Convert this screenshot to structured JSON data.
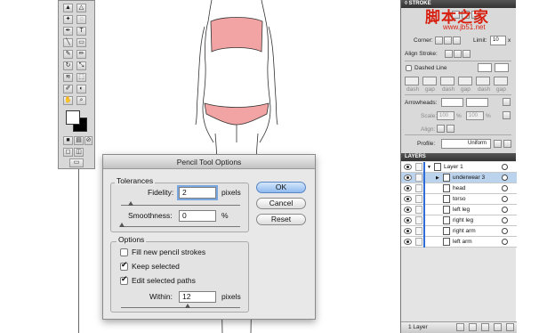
{
  "watermark": {
    "text": "脚本之家",
    "url": "www.jb51.net"
  },
  "stroke_panel": {
    "title": "◊ STROKE",
    "corner_label": "Corner:",
    "limit_label": "Limit:",
    "limit_value": "10",
    "limit_suffix": "x",
    "align_stroke_label": "Align Stroke:",
    "dashed_line_label": "Dashed Line",
    "dash_labels": [
      "dash",
      "gap",
      "dash",
      "gap",
      "dash",
      "gap"
    ],
    "arrowheads_label": "Arrowheads:",
    "scale_label": "Scale:",
    "scale_start": "100",
    "scale_end": "100",
    "scale_unit": "%",
    "align_label": "Align:",
    "profile_label": "Profile:",
    "profile_value": "Uniform"
  },
  "layers_panel": {
    "title": "LAYERS",
    "layers": [
      {
        "name": "Layer 1",
        "selected": false,
        "level": 0
      },
      {
        "name": "underwear 3",
        "selected": true,
        "level": 1
      },
      {
        "name": "head",
        "selected": false,
        "level": 1
      },
      {
        "name": "torso",
        "selected": false,
        "level": 1
      },
      {
        "name": "left leg",
        "selected": false,
        "level": 1
      },
      {
        "name": "right leg",
        "selected": false,
        "level": 1
      },
      {
        "name": "right arm",
        "selected": false,
        "level": 1
      },
      {
        "name": "left arm",
        "selected": false,
        "level": 1
      }
    ],
    "footer_label": "1 Layer"
  },
  "dialog": {
    "title": "Pencil Tool Options",
    "tolerances": {
      "label": "Tolerances",
      "fidelity_label": "Fidelity:",
      "fidelity_value": "2",
      "fidelity_unit": "pixels",
      "smoothness_label": "Smoothness:",
      "smoothness_value": "0",
      "smoothness_unit": "%"
    },
    "options": {
      "label": "Options",
      "fill_new_label": "Fill new pencil strokes",
      "fill_new_checked": false,
      "keep_selected_label": "Keep selected",
      "keep_selected_checked": true,
      "edit_selected_label": "Edit selected paths",
      "edit_selected_checked": true,
      "within_label": "Within:",
      "within_value": "12",
      "within_unit": "pixels"
    },
    "buttons": {
      "ok": "OK",
      "cancel": "Cancel",
      "reset": "Reset"
    }
  },
  "colors": {
    "underwear": "#f2a3a3",
    "accent": "#2e6bd6",
    "watermark": "#d82010"
  }
}
